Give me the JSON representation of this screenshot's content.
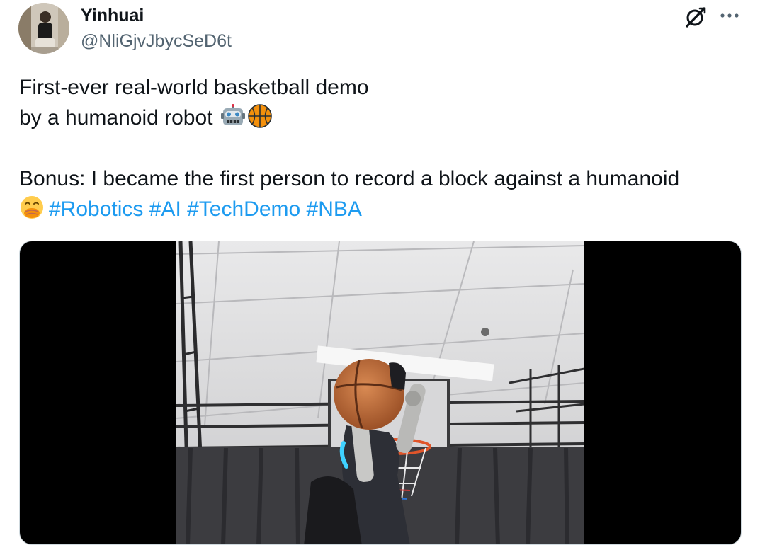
{
  "author": {
    "display_name": "Yinhuai",
    "handle": "@NliGjvJbycSeD6t"
  },
  "header_icons": {
    "grok": "grok-icon",
    "more": "more-horizontal-icon"
  },
  "tweet": {
    "line1": "First-ever real-world basketball demo",
    "line2": "by a humanoid robot",
    "line2_emojis": [
      "robot-emoji",
      "basketball-emoji"
    ],
    "line3": "Bonus: I became the first person to record a block against a humanoid",
    "line4_emoji": "face-with-hand-over-mouth-emoji",
    "hashtags": [
      "#Robotics",
      "#AI",
      "#TechDemo",
      "#NBA"
    ]
  },
  "media": {
    "kind": "video",
    "description_icon": "video-frame",
    "colors": {
      "letterbox": "#000000",
      "hashtag": "#1d9bf0",
      "secondary_text": "#536471"
    }
  }
}
